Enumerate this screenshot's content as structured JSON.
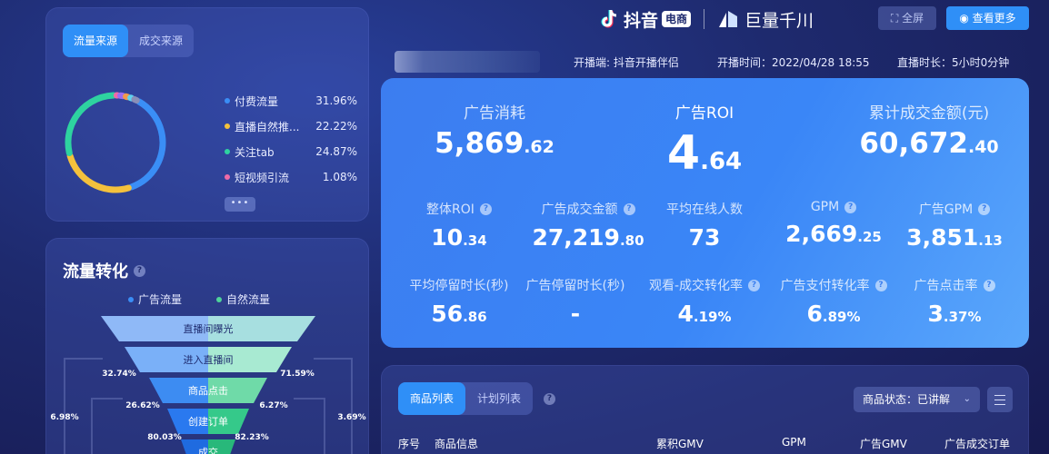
{
  "source": {
    "tabs": [
      "流量来源",
      "成交来源"
    ],
    "items": [
      {
        "name": "付费流量",
        "pct": "31.96%",
        "color": "#3a8ef6"
      },
      {
        "name": "直播自然推...",
        "pct": "22.22%",
        "color": "#f4c13c"
      },
      {
        "name": "关注tab",
        "pct": "24.87%",
        "color": "#2ed3a0"
      },
      {
        "name": "短视频引流",
        "pct": "1.08%",
        "color": "#ef6aa7"
      }
    ],
    "more": "•••"
  },
  "funnel": {
    "title": "流量转化",
    "legend": [
      "广告流量",
      "自然流量"
    ],
    "legend_colors": [
      "#3a8ef6",
      "#4fd49a"
    ],
    "stages": [
      "直播间曝光",
      "进入直播间",
      "商品点击",
      "创建订单",
      "成交"
    ],
    "left_rates": [
      "32.74%",
      "26.62%",
      "80.03%"
    ],
    "right_rates": [
      "71.59%",
      "6.27%",
      "82.23%"
    ],
    "outer_left": "6.98%",
    "outer_right": "3.69%"
  },
  "header": {
    "brand1": "抖音",
    "brand1_tag": "电商",
    "brand2": "巨量千川",
    "fullscreen": "全屏",
    "view_more": "查看更多",
    "platform": "开播端: 抖音开播伴侣",
    "start_time": "开播时间：2022/04/28 18:55",
    "duration": "直播时长：5小时0分钟"
  },
  "metrics": {
    "big": [
      {
        "label": "广告消耗",
        "int": "5,869",
        "dec": ".62"
      },
      {
        "label": "广告ROI",
        "int": "4",
        "dec": ".64"
      },
      {
        "label": "累计成交金额(元)",
        "int": "60,672",
        "dec": ".40"
      }
    ],
    "small": [
      {
        "label": "整体ROI",
        "int": "10",
        "dec": ".34",
        "help": true
      },
      {
        "label": "广告成交金额",
        "int": "27,219",
        "dec": ".80",
        "help": true
      },
      {
        "label": "平均在线人数",
        "int": "73",
        "dec": "",
        "help": false
      },
      {
        "label": "GPM",
        "int": "2,669",
        "dec": ".25",
        "help": true
      },
      {
        "label": "广告GPM",
        "int": "3,851",
        "dec": ".13",
        "help": true
      },
      {
        "label": "平均停留时长(秒)",
        "int": "56",
        "dec": ".86",
        "help": false
      },
      {
        "label": "广告停留时长(秒)",
        "int": "-",
        "dec": "",
        "help": false
      },
      {
        "label": "观看-成交转化率",
        "int": "4",
        "dec": ".19%",
        "help": true
      },
      {
        "label": "广告支付转化率",
        "int": "6",
        "dec": ".89%",
        "help": true
      },
      {
        "label": "广告点击率",
        "int": "3",
        "dec": ".37%",
        "help": true
      }
    ]
  },
  "list": {
    "tabs": [
      "商品列表",
      "计划列表"
    ],
    "status_label": "商品状态：已讲解",
    "columns": [
      "序号",
      "商品信息",
      "累积GMV",
      "GPM",
      "广告GMV",
      "广告成交订单"
    ]
  }
}
